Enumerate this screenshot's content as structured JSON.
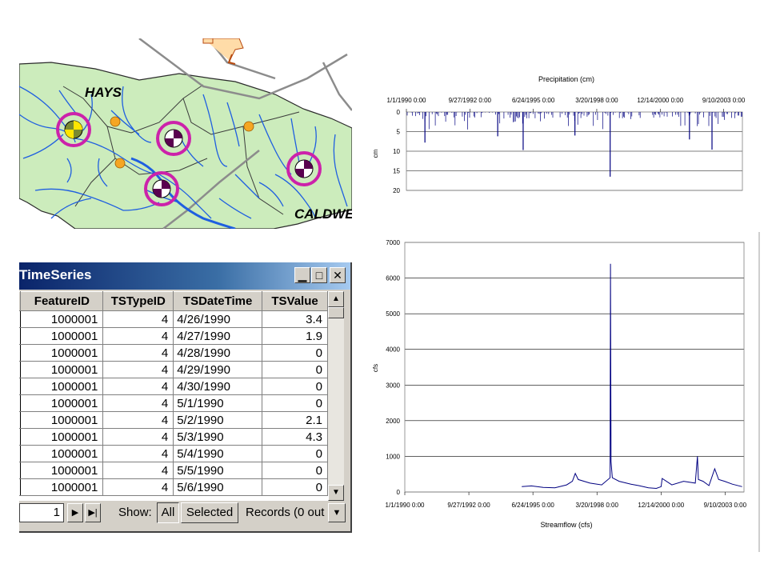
{
  "map": {
    "labels": {
      "county_north": "HAYS",
      "county_east": "CALDWELL"
    },
    "colors": {
      "watershed": "#ccecbc",
      "stream": "#1f5fe0",
      "boundary": "#8c8c8c",
      "gauge_ring": "#cc22aa",
      "precip_point": "#f5a623"
    },
    "icons": {
      "stream_gauge": "gauge-icon",
      "rain_gauge": "precip-point-icon"
    }
  },
  "precip_chart": {
    "chart_data": {
      "type": "bar",
      "title": "Precipitation (cm)",
      "ylabel": "cm",
      "xlabel": "",
      "x_ticks": [
        "1/1/1990 0:00",
        "9/27/1992 0:00",
        "6/24/1995 0:00",
        "3/20/1998 0:00",
        "12/14/2000 0:00",
        "9/10/2003 0:00"
      ],
      "y_ticks": [
        0,
        5,
        10,
        15,
        20
      ],
      "ylim": [
        0,
        20
      ],
      "y_inverted": true,
      "x_axis_position": "top",
      "grid": true,
      "series_color": "#000080",
      "notable_values": [
        {
          "date": "1990-10-20",
          "value": 7.8
        },
        {
          "date": "1993-12-10",
          "value": 6.2
        },
        {
          "date": "1995-01-15",
          "value": 9.7
        },
        {
          "date": "1997-04-10",
          "value": 6.0
        },
        {
          "date": "1998-10-17",
          "value": 16.5
        },
        {
          "date": "2002-03-20",
          "value": 7.0
        },
        {
          "date": "2003-03-10",
          "value": 9.6
        }
      ]
    }
  },
  "flow_chart": {
    "chart_data": {
      "type": "line",
      "title": "",
      "xlabel": "Streamflow (cfs)",
      "ylabel": "cfs",
      "x_ticks": [
        "1/1/1990 0:00",
        "9/27/1992 0:00",
        "6/24/1995 0:00",
        "3/20/1998 0:00",
        "12/14/2000 0:00",
        "9/10/2003 0:00"
      ],
      "y_ticks": [
        0,
        1000,
        2000,
        3000,
        4000,
        5000,
        6000,
        7000
      ],
      "ylim": [
        0,
        7000
      ],
      "grid": true,
      "series_color": "#000080",
      "series": [
        {
          "dates": [
            "1995-01-01",
            "1995-06-01",
            "1995-12-01",
            "1996-06-01",
            "1996-12-01",
            "1997-03-01",
            "1997-04-15",
            "1997-06-01",
            "1997-12-01",
            "1998-06-01",
            "1998-10-10",
            "1998-10-17",
            "1998-10-25",
            "1998-11-15",
            "1999-03-01",
            "1999-09-01",
            "2000-01-01",
            "2000-06-01",
            "2000-10-01",
            "2000-12-15",
            "2001-01-01",
            "2001-06-01",
            "2001-12-01",
            "2002-06-01",
            "2002-07-05",
            "2002-07-20",
            "2002-10-01",
            "2003-01-01",
            "2003-04-01",
            "2003-06-01",
            "2003-09-01",
            "2004-01-01",
            "2004-06-01"
          ],
          "values": [
            150,
            170,
            130,
            120,
            200,
            300,
            520,
            350,
            250,
            200,
            400,
            6400,
            850,
            400,
            300,
            220,
            180,
            120,
            100,
            150,
            380,
            200,
            300,
            250,
            1000,
            350,
            300,
            180,
            650,
            350,
            300,
            220,
            150
          ]
        }
      ]
    }
  },
  "table_window": {
    "title": "TimeSeries",
    "columns": [
      "FeatureID",
      "TSTypeID",
      "TSDateTime",
      "TSValue"
    ],
    "rows": [
      [
        "1000001",
        "4",
        "4/26/1990",
        "3.4"
      ],
      [
        "1000001",
        "4",
        "4/27/1990",
        "1.9"
      ],
      [
        "1000001",
        "4",
        "4/28/1990",
        "0"
      ],
      [
        "1000001",
        "4",
        "4/29/1990",
        "0"
      ],
      [
        "1000001",
        "4",
        "4/30/1990",
        "0"
      ],
      [
        "1000001",
        "4",
        "5/1/1990",
        "0"
      ],
      [
        "1000001",
        "4",
        "5/2/1990",
        "2.1"
      ],
      [
        "1000001",
        "4",
        "5/3/1990",
        "4.3"
      ],
      [
        "1000001",
        "4",
        "5/4/1990",
        "0"
      ],
      [
        "1000001",
        "4",
        "5/5/1990",
        "0"
      ],
      [
        "1000001",
        "4",
        "5/6/1990",
        "0"
      ]
    ],
    "status": {
      "record_value": "1",
      "show_label": "Show:",
      "all_label": "All",
      "selected_label": "Selected",
      "records_text": "Records  (0 out"
    },
    "icons": [
      "minimize-icon",
      "maximize-icon",
      "close-icon",
      "next-record-icon",
      "last-record-icon",
      "scroll-up-icon",
      "scroll-down-icon",
      "dropdown-icon"
    ]
  }
}
